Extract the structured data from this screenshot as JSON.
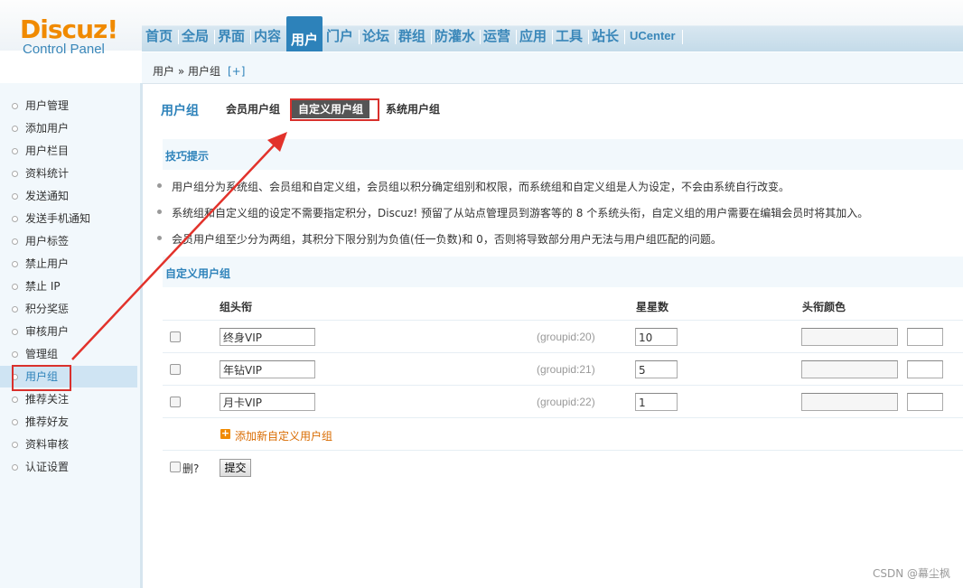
{
  "logo": {
    "brand": "Discuz!",
    "sub": "Control Panel"
  },
  "nav": {
    "items": [
      "首页",
      "全局",
      "界面",
      "内容",
      "用户",
      "门户",
      "论坛",
      "群组",
      "防灌水",
      "运营",
      "应用",
      "工具",
      "站长",
      "UCenter"
    ],
    "active": "用户"
  },
  "breadcrumb": {
    "path": "用户 » 用户组",
    "plus": "[+]"
  },
  "sidebar": {
    "items": [
      "用户管理",
      "添加用户",
      "用户栏目",
      "资料统计",
      "发送通知",
      "发送手机通知",
      "用户标签",
      "禁止用户",
      "禁止 IP",
      "积分奖惩",
      "审核用户",
      "管理组",
      "用户组",
      "推荐关注",
      "推荐好友",
      "资料审核",
      "认证设置"
    ],
    "active": "用户组"
  },
  "subtabs": {
    "title": "用户组",
    "tabs": [
      "会员用户组",
      "自定义用户组",
      "系统用户组"
    ],
    "active": "自定义用户组"
  },
  "tips": {
    "title": "技巧提示",
    "items": [
      "用户组分为系统组、会员组和自定义组，会员组以积分确定组别和权限，而系统组和自定义组是人为设定，不会由系统自行改变。",
      "系统组和自定义组的设定不需要指定积分，Discuz! 预留了从站点管理员到游客等的 8 个系统头衔，自定义组的用户需要在编辑会员时将其加入。",
      "会员用户组至少分为两组，其积分下限分别为负值(任一负数)和 0，否则将导致部分用户无法与用户组匹配的问题。"
    ]
  },
  "custom": {
    "title": "自定义用户组",
    "headers": {
      "name": "组头衔",
      "stars": "星星数",
      "color": "头衔颜色"
    },
    "rows": [
      {
        "name": "终身VIP",
        "gid": "(groupid:20)",
        "stars": "10"
      },
      {
        "name": "年钻VIP",
        "gid": "(groupid:21)",
        "stars": "5"
      },
      {
        "name": "月卡VIP",
        "gid": "(groupid:22)",
        "stars": "1"
      }
    ],
    "add_label": "添加新自定义用户组",
    "delete_label": "删?",
    "submit_label": "提交"
  },
  "watermark": "CSDN @幕尘枫",
  "colors": {
    "accent": "#2d82ba",
    "brand": "#f08a00",
    "highlight": "#d9302c"
  }
}
